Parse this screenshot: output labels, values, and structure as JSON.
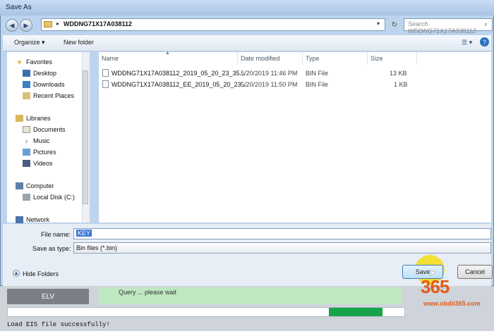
{
  "window": {
    "title": "Save As"
  },
  "address": {
    "path": "WDDNG71X17A038112",
    "search_placeholder": "Search WDDNG71X17A038112"
  },
  "toolbar": {
    "organize": "Organize ▾",
    "new_folder": "New folder"
  },
  "nav": {
    "favorites": {
      "label": "Favorites",
      "items": [
        "Desktop",
        "Downloads",
        "Recent Places"
      ]
    },
    "libraries": {
      "label": "Libraries",
      "items": [
        "Documents",
        "Music",
        "Pictures",
        "Videos"
      ]
    },
    "computer": {
      "label": "Computer",
      "items": [
        "Local Disk (C:)"
      ]
    },
    "network": {
      "label": "Network"
    }
  },
  "columns": {
    "name": "Name",
    "date": "Date modified",
    "type": "Type",
    "size": "Size"
  },
  "files": [
    {
      "name": "WDDNG71X17A038112_2019_05_20_23_35...",
      "date": "5/20/2019 11:46 PM",
      "type": "BIN File",
      "size": "13 KB"
    },
    {
      "name": "WDDNG71X17A038112_EE_2019_05_20_23...",
      "date": "5/20/2019 11:50 PM",
      "type": "BIN File",
      "size": "1 KB"
    }
  ],
  "form": {
    "file_name_label": "File name:",
    "file_name_value": "KEY",
    "save_type_label": "Save as type:",
    "save_type_value": "Bin files (*.bin)"
  },
  "footer": {
    "hide_folders": "Hide Folders",
    "save": "Save",
    "cancel": "Cancel"
  },
  "background": {
    "elv": "ELV",
    "status": "Load EIS file successfully!",
    "panel_text": "Query ... please wait",
    "progress": 0.14
  },
  "watermark": {
    "number": "365",
    "url": "www.obdii365.com"
  }
}
